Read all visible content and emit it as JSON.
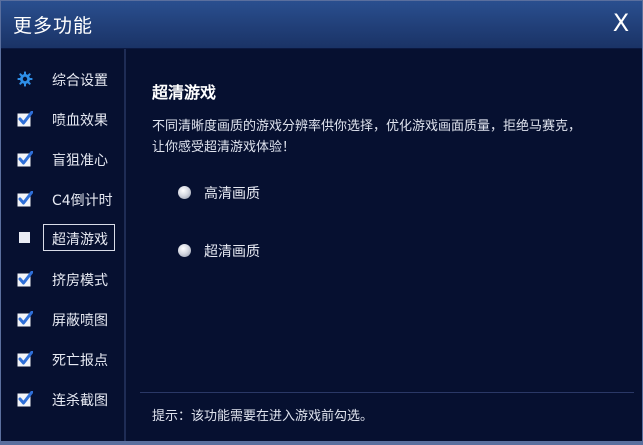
{
  "window": {
    "title": "更多功能",
    "close_label": "X"
  },
  "sidebar": {
    "items": [
      {
        "label": "综合设置",
        "icon": "gear-icon",
        "checked": null
      },
      {
        "label": "喷血效果",
        "icon": "checkbox-checked-icon",
        "checked": true
      },
      {
        "label": "盲狙准心",
        "icon": "checkbox-checked-icon",
        "checked": true
      },
      {
        "label": "C4倒计时",
        "icon": "checkbox-checked-icon",
        "checked": true
      },
      {
        "label": "超清游戏",
        "icon": "square-icon",
        "checked": false,
        "active": true
      },
      {
        "label": "挤房模式",
        "icon": "checkbox-checked-icon",
        "checked": true
      },
      {
        "label": "屏蔽喷图",
        "icon": "checkbox-checked-icon",
        "checked": true
      },
      {
        "label": "死亡报点",
        "icon": "checkbox-checked-icon",
        "checked": true
      },
      {
        "label": "连杀截图",
        "icon": "checkbox-checked-icon",
        "checked": true
      }
    ]
  },
  "content": {
    "title": "超清游戏",
    "description": "不同清晰度画质的游戏分辨率供你选择，优化游戏画面质量，拒绝马赛克，让你感受超清游戏体验！",
    "options": [
      {
        "label": "高清画质"
      },
      {
        "label": "超清画质"
      }
    ],
    "hint": "提示：该功能需要在进入游戏前勾选。"
  },
  "colors": {
    "background": "#061030",
    "titlebar": "#213f78",
    "check_blue": "#2e6fd8"
  }
}
